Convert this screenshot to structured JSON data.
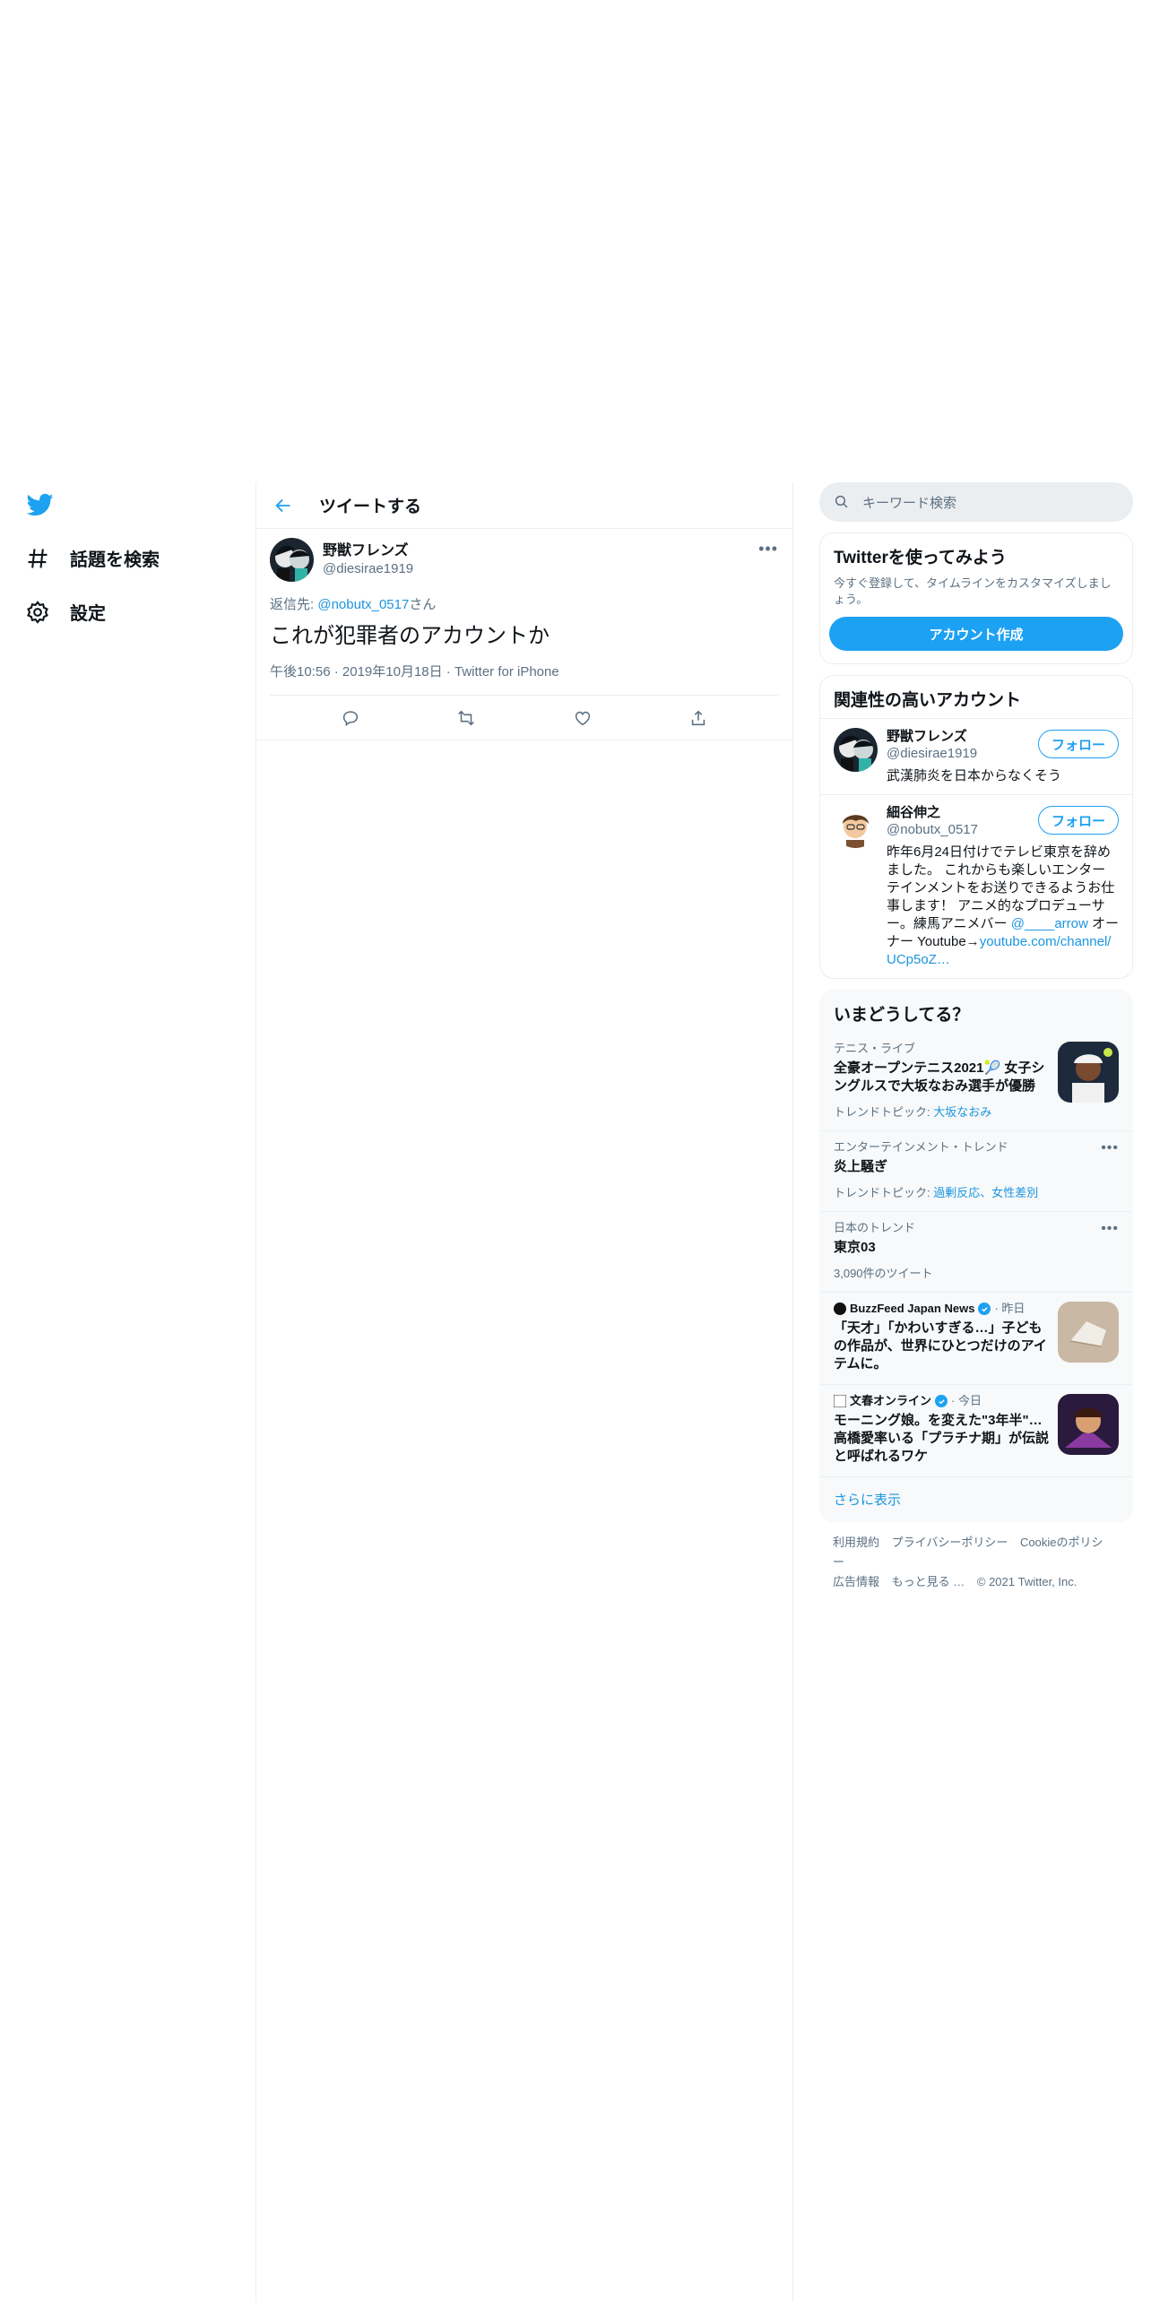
{
  "nav": {
    "items": [
      {
        "label": "話題を検索"
      },
      {
        "label": "設定"
      }
    ]
  },
  "main": {
    "title": "ツイートする",
    "tweet": {
      "display_name": "野獣フレンズ",
      "handle": "@diesirae1919",
      "reply_prefix": "返信先: ",
      "reply_handle": "@nobutx_0517",
      "reply_suffix": "さん",
      "text": "これが犯罪者のアカウントか",
      "time": "午後10:56",
      "date": "2019年10月18日",
      "source": "Twitter for iPhone"
    }
  },
  "right": {
    "search_placeholder": "キーワード検索",
    "signup": {
      "title": "Twitterを使ってみよう",
      "desc": "今すぐ登録して、タイムラインをカスタマイズしましょう。",
      "button": "アカウント作成"
    },
    "related": {
      "title": "関連性の高いアカウント",
      "follow_label": "フォロー",
      "users": [
        {
          "name": "野獣フレンズ",
          "handle": "@diesirae1919",
          "bio": "武漢肺炎を日本からなくそう"
        },
        {
          "name": "細谷伸之",
          "handle": "@nobutx_0517",
          "bio": "昨年6月24日付けでテレビ東京を辞めました。 これからも楽しいエンターテインメントをお送りできるようお仕事します！ アニメ的なプロデューサー。練馬アニメバー ",
          "bio_link": "@____arrow",
          "bio_mid": " オーナー Youtube→",
          "bio_link2": "youtube.com/channel/UCp5oZ…"
        }
      ]
    },
    "trends": {
      "title": "いまどうしてる？",
      "items": [
        {
          "category": "テニス・ライブ",
          "title": "全豪オープンテニス2021🎾 女子シングルスで大坂なおみ選手が優勝",
          "sub_prefix": "トレンドトピック: ",
          "sub_links": "大坂なおみ"
        },
        {
          "category": "エンターテインメント・トレンド",
          "title": "炎上騒ぎ",
          "sub_prefix": "トレンドトピック: ",
          "sub_links": "過剰反応、女性差別"
        },
        {
          "category": "日本のトレンド",
          "title": "東京03",
          "sub": "3,090件のツイート"
        },
        {
          "source": "BuzzFeed Japan News",
          "time": "昨日",
          "title": "「天才」「かわいすぎる…」子どもの作品が、世界にひとつだけのアイテムに。"
        },
        {
          "source": "文春オンライン",
          "time": "今日",
          "title": "モーニング娘。を変えた\"3年半\"…高橋愛率いる「プラチナ期」が伝説と呼ばれるワケ"
        }
      ],
      "show_more": "さらに表示"
    },
    "footer": {
      "links": [
        "利用規約",
        "プライバシーポリシー",
        "Cookieのポリシー",
        "広告情報",
        "もっと見る …",
        "© 2021 Twitter, Inc."
      ]
    }
  },
  "colors": {
    "accent": "#1da1f2",
    "link": "#1b95e0",
    "muted": "#5b7083",
    "border": "#ebeef0"
  }
}
